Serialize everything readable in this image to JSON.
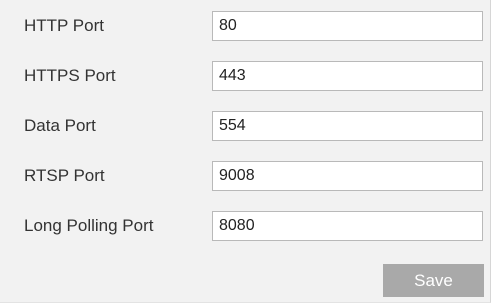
{
  "fields": [
    {
      "label": "HTTP Port",
      "value": "80"
    },
    {
      "label": "HTTPS Port",
      "value": "443"
    },
    {
      "label": "Data Port",
      "value": "554"
    },
    {
      "label": "RTSP Port",
      "value": "9008"
    },
    {
      "label": "Long Polling Port",
      "value": "8080"
    }
  ],
  "actions": {
    "save_label": "Save"
  },
  "colors": {
    "panel_background": "#f2f2f2",
    "input_border": "#b9b9b9",
    "button_background": "#a9a9a9",
    "button_text": "#ffffff"
  }
}
